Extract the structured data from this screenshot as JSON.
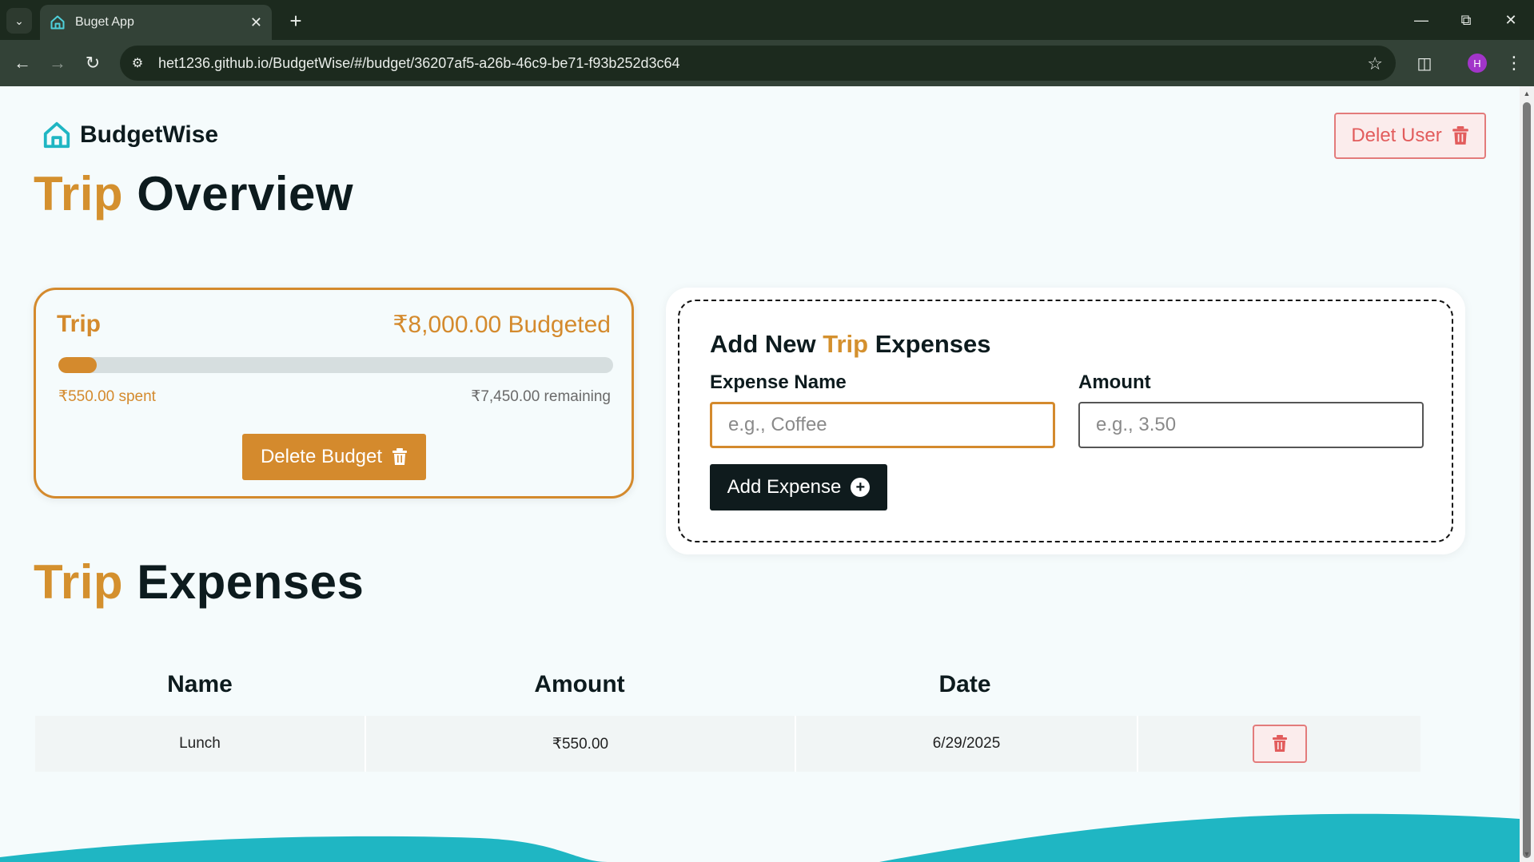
{
  "browser": {
    "tab_title": "Buget App",
    "url": "het1236.github.io/BudgetWise/#/budget/36207af5-a26b-46c9-be71-f93b252d3c64",
    "profile_initial": "H"
  },
  "header": {
    "brand": "BudgetWise",
    "delete_user_label": "Delet User"
  },
  "overview": {
    "title_accent": "Trip",
    "title_rest": "Overview"
  },
  "budget": {
    "name": "Trip",
    "budgeted": "₹8,000.00 Budgeted",
    "spent": "₹550.00 spent",
    "remaining": "₹7,450.00 remaining",
    "progress_fraction": 0.06875,
    "delete_label": "Delete Budget"
  },
  "form": {
    "title_prefix": "Add New",
    "title_accent": "Trip",
    "title_suffix": "Expenses",
    "name_label": "Expense Name",
    "name_placeholder": "e.g., Coffee",
    "amount_label": "Amount",
    "amount_placeholder": "e.g., 3.50",
    "submit_label": "Add Expense"
  },
  "expenses": {
    "title_accent": "Trip",
    "title_rest": "Expenses",
    "columns": [
      "Name",
      "Amount",
      "Date"
    ],
    "rows": [
      {
        "name": "Lunch",
        "amount": "₹550.00",
        "date": "6/29/2025"
      }
    ]
  },
  "colors": {
    "accent": "#d48a2d",
    "brand": "#1fb6c3",
    "danger": "#e25c5c",
    "dark": "#0f1b1d"
  }
}
